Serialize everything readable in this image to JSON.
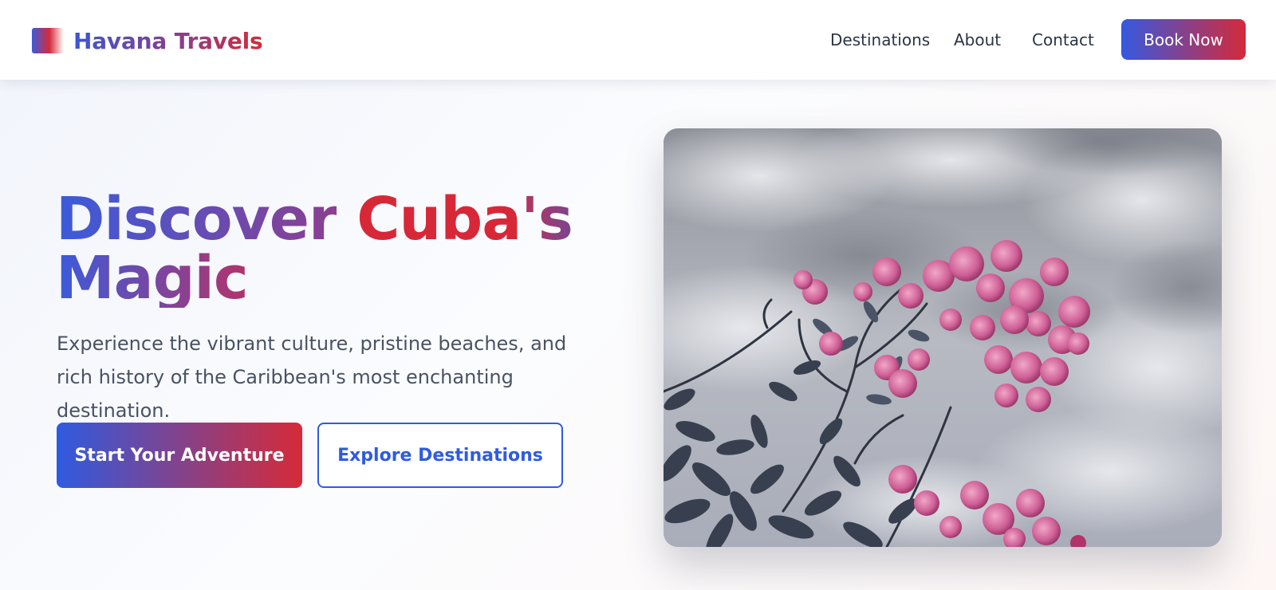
{
  "header": {
    "brand_name": "Havana Travels",
    "nav": [
      {
        "label": "Destinations"
      },
      {
        "label": "About"
      },
      {
        "label": "Contact"
      }
    ],
    "cta_label": "Book Now"
  },
  "hero": {
    "title_line1_word1": "Discover",
    "title_line1_word2": "Cuba",
    "title_line1_word3": "'s",
    "title_line2": "Magic",
    "subtitle": "Experience the vibrant culture, pristine beaches, and rich history of the Caribbean's most enchanting destination.",
    "primary_button": "Start Your Adventure",
    "secondary_button": "Explore Destinations"
  },
  "colors": {
    "brand_blue": "#3b5bdb",
    "brand_red": "#d62a38",
    "text_dark": "#2b3445",
    "text_body": "#4a5262"
  }
}
